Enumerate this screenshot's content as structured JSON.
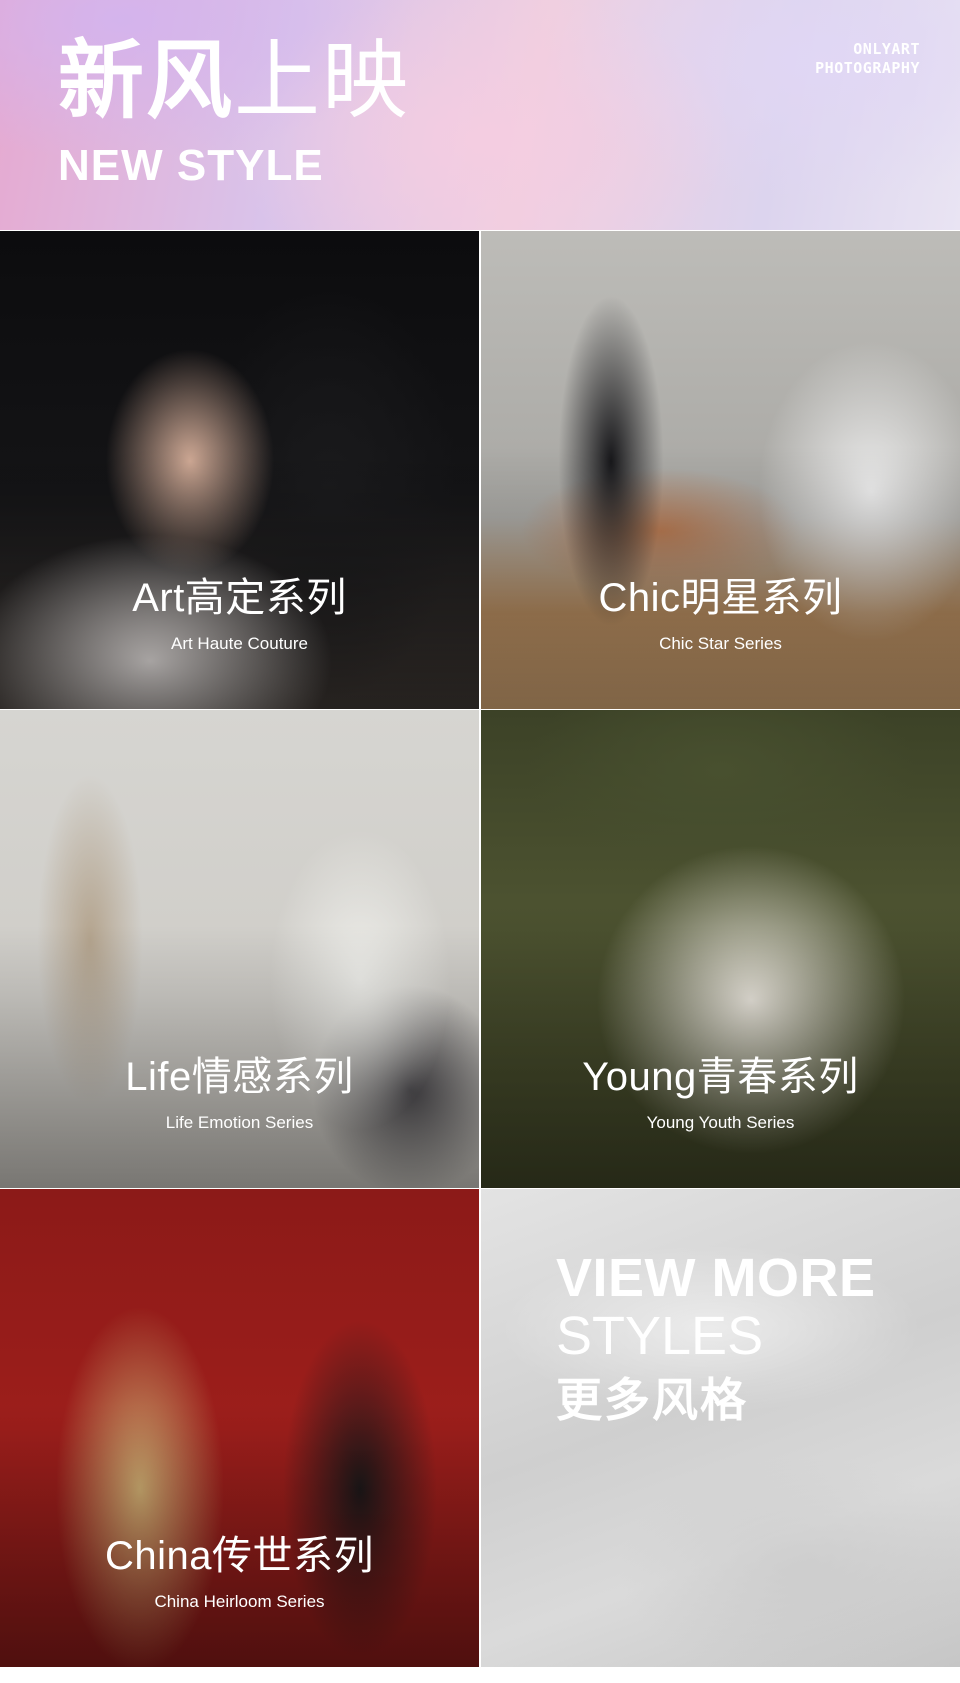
{
  "header": {
    "title_cn_bold": "新风",
    "title_cn_thin": "上映",
    "title_en": "NEW STYLE",
    "brand_line1": "ONLYART",
    "brand_line2": "PHOTOGRAPHY"
  },
  "series": [
    {
      "title_cn": "Art高定系列",
      "title_en": "Art Haute Couture"
    },
    {
      "title_cn": "Chic明星系列",
      "title_en": "Chic Star Series"
    },
    {
      "title_cn": "Life情感系列",
      "title_en": "Life Emotion Series"
    },
    {
      "title_cn": "Young青春系列",
      "title_en": "Young Youth Series"
    },
    {
      "title_cn": "China传世系列",
      "title_en": "China Heirloom Series"
    }
  ],
  "view_more": {
    "line1": "VIEW MORE",
    "line2": "STYLES",
    "line3": "更多风格"
  }
}
